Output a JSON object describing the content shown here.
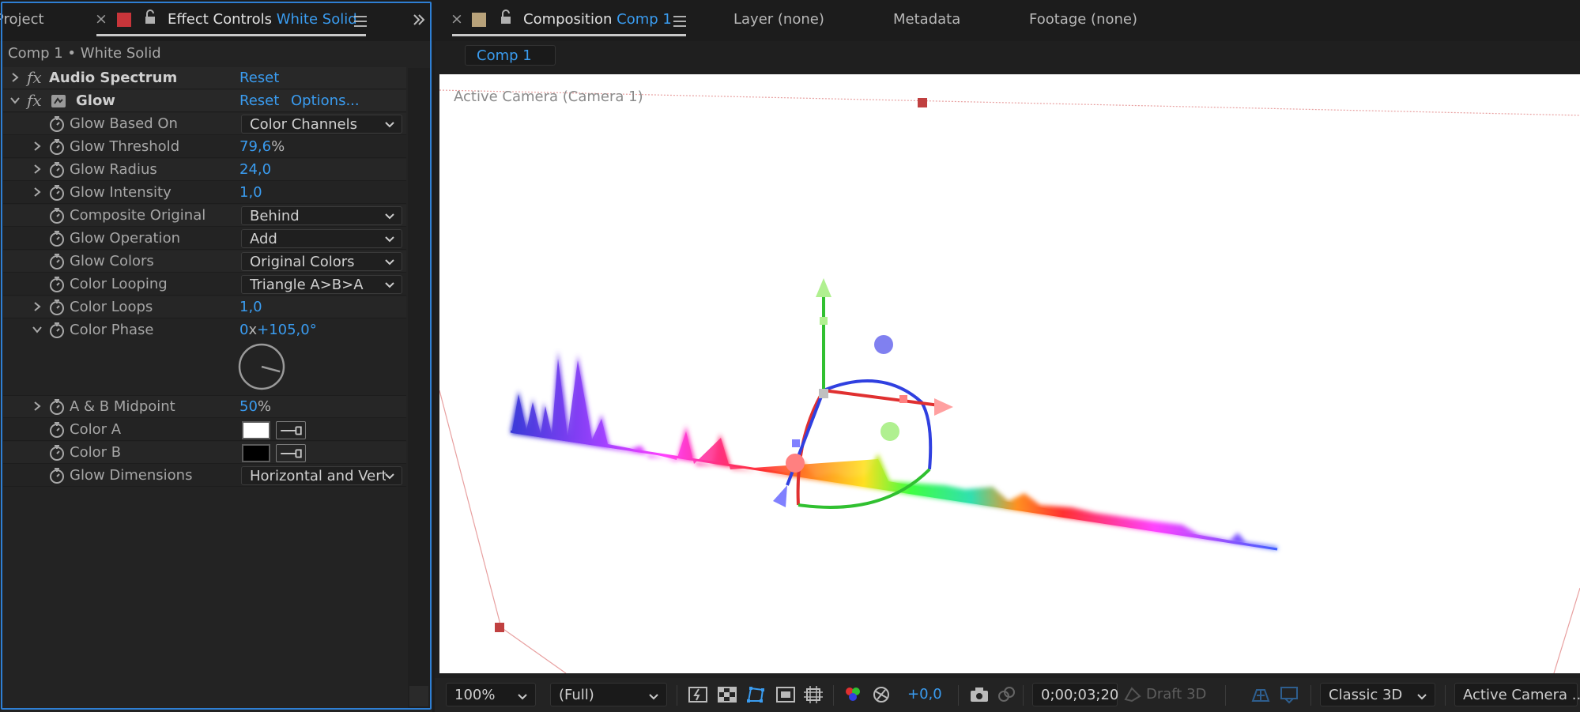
{
  "left_tabs": {
    "project": "Project",
    "effect_controls_prefix": "Effect Controls",
    "effect_controls_layer": "White Solid"
  },
  "breadcrumb": "Comp 1 • White Solid",
  "effects": [
    {
      "name": "Audio Spectrum",
      "reset": "Reset"
    },
    {
      "name": "Glow",
      "reset": "Reset",
      "options": "Options..."
    }
  ],
  "properties": {
    "glow_based_on": {
      "label": "Glow Based On",
      "value": "Color Channels"
    },
    "glow_threshold": {
      "label": "Glow Threshold",
      "value": "79,6",
      "unit": "%"
    },
    "glow_radius": {
      "label": "Glow Radius",
      "value": "24,0"
    },
    "glow_intensity": {
      "label": "Glow Intensity",
      "value": "1,0"
    },
    "composite_original": {
      "label": "Composite Original",
      "value": "Behind"
    },
    "glow_operation": {
      "label": "Glow Operation",
      "value": "Add"
    },
    "glow_colors": {
      "label": "Glow Colors",
      "value": "Original Colors"
    },
    "color_looping": {
      "label": "Color Looping",
      "value": "Triangle A>B>A"
    },
    "color_loops": {
      "label": "Color Loops",
      "value": "1,0"
    },
    "color_phase": {
      "label": "Color Phase",
      "revolutions": "0",
      "sep": "x",
      "degrees": "+105,0°"
    },
    "ab_midpoint": {
      "label": "A & B Midpoint",
      "value": "50",
      "unit": "%"
    },
    "color_a": {
      "label": "Color A",
      "color": "#ffffff"
    },
    "color_b": {
      "label": "Color B",
      "color": "#000000"
    },
    "glow_dimensions": {
      "label": "Glow Dimensions",
      "value": "Horizontal and Vertical"
    }
  },
  "right_tabs": {
    "composition_prefix": "Composition",
    "composition_name": "Comp 1",
    "layer": "Layer (none)",
    "metadata": "Metadata",
    "footage": "Footage (none)"
  },
  "comp_subtab": "Comp 1",
  "viewer": {
    "label": "Active Camera (Camera 1)"
  },
  "bottom_bar": {
    "zoom": "100%",
    "resolution": "(Full)",
    "exposure": "+0,0",
    "timecode": "0;00;03;20",
    "draft3d": "Draft 3D",
    "renderer": "Classic 3D",
    "view": "Active Camera ..."
  },
  "colors": {
    "accent": "#3a9cf0",
    "panel_border": "#2e7fd4",
    "solid_label": "#c8353a",
    "comp_label": "#b8a27a"
  }
}
